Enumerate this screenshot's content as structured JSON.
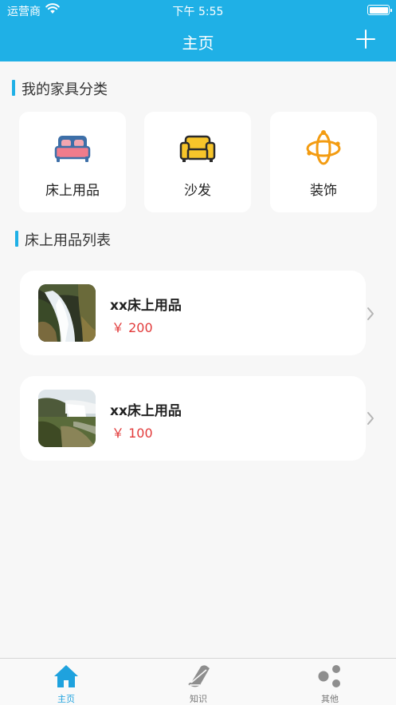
{
  "status_bar": {
    "carrier": "运营商",
    "time": "下午 5:55"
  },
  "nav": {
    "title": "主页",
    "add_icon": "plus-icon"
  },
  "categories_section": {
    "title": "我的家具分类",
    "items": [
      {
        "label": "床上用品",
        "icon": "bed-icon"
      },
      {
        "label": "沙发",
        "icon": "sofa-icon"
      },
      {
        "label": "装饰",
        "icon": "decoration-icon"
      }
    ]
  },
  "list_section": {
    "title": "床上用品列表",
    "items": [
      {
        "name": "xx床上用品",
        "price": "￥ 200",
        "image": "waterfall-photo"
      },
      {
        "name": "xx床上用品",
        "price": "￥ 100",
        "image": "waterfall-landscape-photo"
      }
    ]
  },
  "tabbar": {
    "tabs": [
      {
        "label": "主页",
        "icon": "home-icon",
        "active": true
      },
      {
        "label": "知识",
        "icon": "book-icon",
        "active": false
      },
      {
        "label": "其他",
        "icon": "dots-icon",
        "active": false
      }
    ]
  },
  "colors": {
    "primary": "#1fb0e6",
    "price": "#e23b3b",
    "background": "#f7f7f7"
  }
}
